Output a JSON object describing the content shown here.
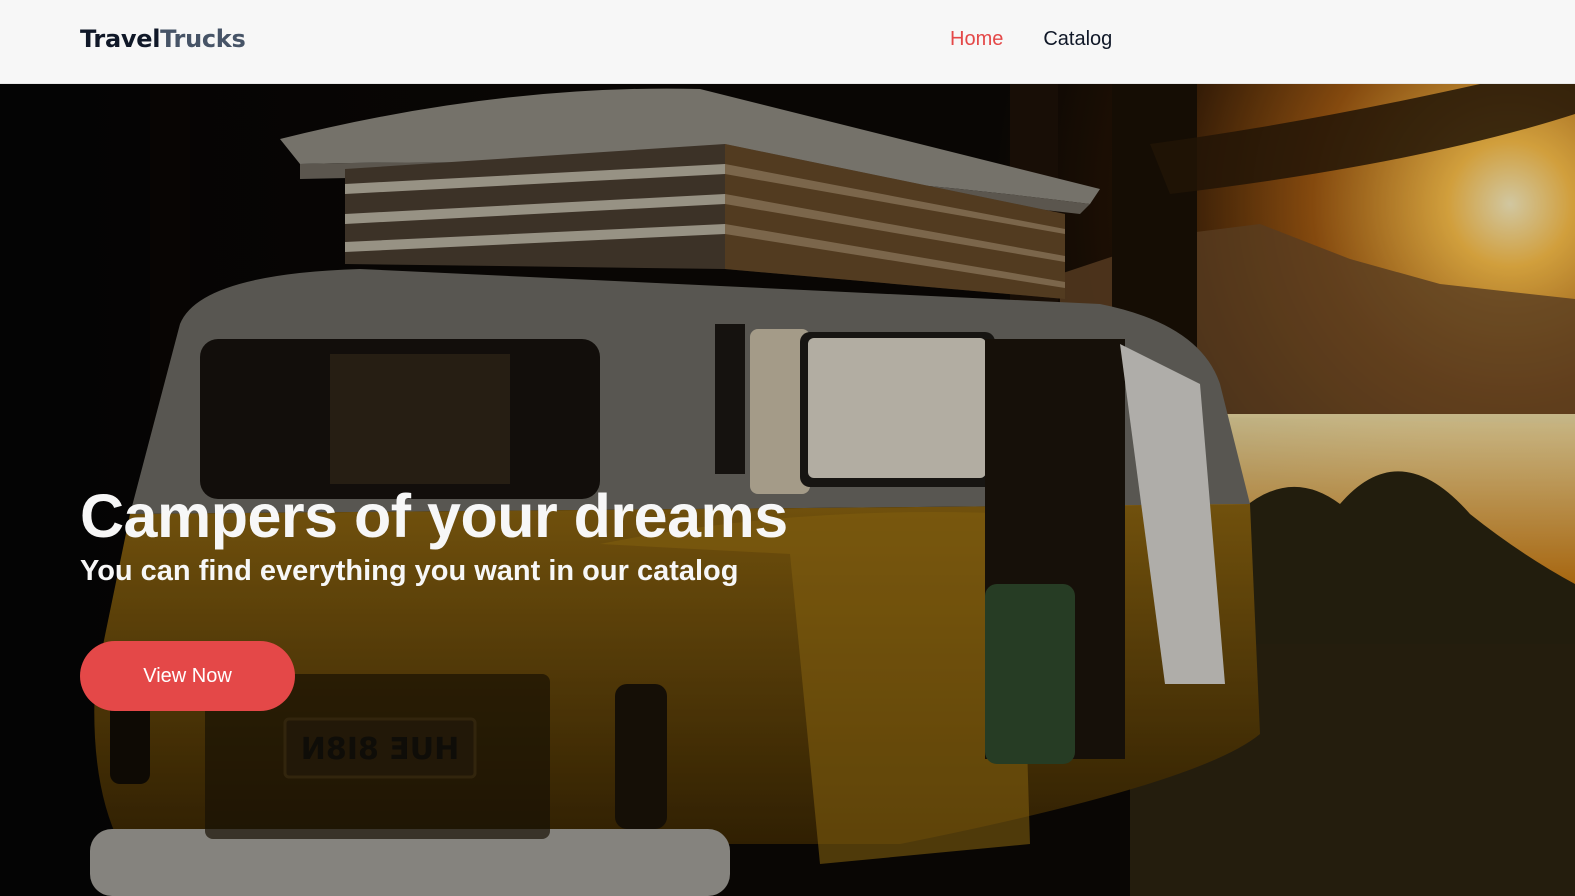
{
  "header": {
    "logo": {
      "part1": "Travel",
      "part2": "Trucks"
    },
    "nav": [
      {
        "label": "Home",
        "active": true
      },
      {
        "label": "Catalog",
        "active": false
      }
    ]
  },
  "hero": {
    "title": "Campers of your dreams",
    "subtitle": "You can find everything you want in our catalog",
    "cta_label": "View Now",
    "image": {
      "subject": "vintage-yellow-camper-van-at-sunset",
      "license_plate_text": "HUE 8I8N"
    }
  },
  "colors": {
    "accent": "#e44848",
    "text_dark": "#101828",
    "text_muted": "#475467",
    "background": "#f7f7f7",
    "hero_text": "#f7f7f7"
  }
}
